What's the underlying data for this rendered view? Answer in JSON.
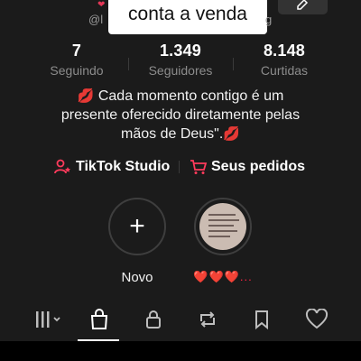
{
  "header": {
    "username_partial": "@l",
    "username_tail": "g",
    "sticker_text": "conta a venda"
  },
  "stats": [
    {
      "value": "7",
      "label": "Seguindo"
    },
    {
      "value": "1.349",
      "label": "Seguidores"
    },
    {
      "value": "8.148",
      "label": "Curtidas"
    }
  ],
  "bio": {
    "line1": "Cada momento contigo é um",
    "line2": "presente oferecido diretamente pelas",
    "line3": "mãos de Deus\".",
    "emoji_start": "💋",
    "emoji_end": "💋"
  },
  "links": {
    "studio": "TikTok Studio",
    "orders": "Seus pedidos"
  },
  "highlights": [
    {
      "label": "Novo",
      "icon": "plus-icon"
    },
    {
      "label": "❤️❤️❤️...",
      "icon": "image-thumbnail"
    }
  ],
  "tabs": [
    "grid-icon",
    "shop-bag-icon",
    "lock-icon",
    "repost-icon",
    "bookmark-icon",
    "heart-icon"
  ],
  "colors": {
    "background": "#1b1b1b",
    "accent": "#e53757",
    "muted": "#8c8c8c"
  }
}
